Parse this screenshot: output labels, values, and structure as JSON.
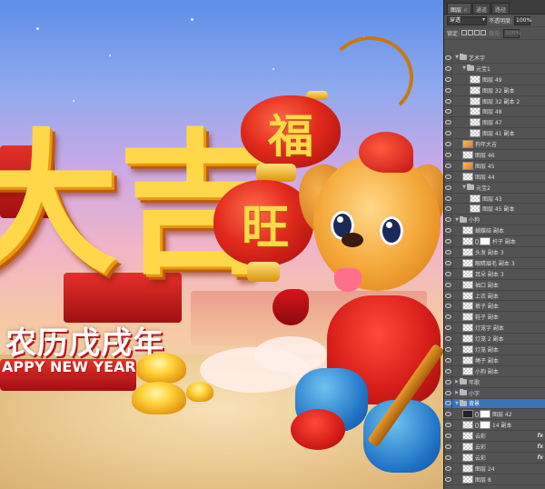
{
  "canvas": {
    "art_text_cn_big": "大吉",
    "lantern_top_char": "福",
    "lantern_bottom_char": "旺",
    "banner_cn": "农历戊戌年",
    "banner_en": "APPY NEW YEAR"
  },
  "panel": {
    "tabs": [
      {
        "label": "图层",
        "close": "×"
      },
      {
        "label": "通道"
      },
      {
        "label": "路径"
      }
    ],
    "blend_mode": "穿透",
    "opacity_label": "不透明度:",
    "opacity_value": "100%",
    "lock_label": "锁定:",
    "fill_label": "填充:",
    "fill_value": "100%",
    "layers": [
      {
        "name": "艺术字",
        "kind": "folder",
        "indent": 0,
        "open": true
      },
      {
        "name": "元宝1",
        "kind": "folder",
        "indent": 1,
        "open": true
      },
      {
        "name": "图层 49",
        "kind": "layer",
        "indent": 2
      },
      {
        "name": "图层 32 副本",
        "kind": "layer",
        "indent": 2
      },
      {
        "name": "图层 32 副本 2",
        "kind": "layer",
        "indent": 2
      },
      {
        "name": "图层 48",
        "kind": "layer",
        "indent": 2
      },
      {
        "name": "图层 47",
        "kind": "layer",
        "indent": 2
      },
      {
        "name": "图层 41 副本",
        "kind": "layer",
        "indent": 2
      },
      {
        "name": "狗年大吉",
        "kind": "layer",
        "indent": 1,
        "thumb": "art"
      },
      {
        "name": "图层 46",
        "kind": "layer",
        "indent": 1
      },
      {
        "name": "图层 45",
        "kind": "layer",
        "indent": 1,
        "thumb": "art"
      },
      {
        "name": "图层 44",
        "kind": "layer",
        "indent": 1
      },
      {
        "name": "元宝2",
        "kind": "folder",
        "indent": 1,
        "open": true
      },
      {
        "name": "图层 43",
        "kind": "layer",
        "indent": 2
      },
      {
        "name": "图层 45 副本",
        "kind": "layer",
        "indent": 2
      },
      {
        "name": "小狗",
        "kind": "folder",
        "indent": 0,
        "open": true
      },
      {
        "name": "蝴蝶结 副本",
        "kind": "layer",
        "indent": 1
      },
      {
        "name": "杆子 副本",
        "kind": "masked",
        "indent": 1
      },
      {
        "name": "头发 副本 3",
        "kind": "layer",
        "indent": 1
      },
      {
        "name": "眼睛眉毛 副本 3",
        "kind": "layer",
        "indent": 1
      },
      {
        "name": "耳朵 副本 3",
        "kind": "layer",
        "indent": 1
      },
      {
        "name": "袖口 副本",
        "kind": "layer",
        "indent": 1
      },
      {
        "name": "上衣 副本",
        "kind": "layer",
        "indent": 1
      },
      {
        "name": "裤子 副本",
        "kind": "layer",
        "indent": 1
      },
      {
        "name": "鞋子 副本",
        "kind": "layer",
        "indent": 1
      },
      {
        "name": "灯笼字 副本",
        "kind": "layer",
        "indent": 1
      },
      {
        "name": "灯笼 2 副本",
        "kind": "layer",
        "indent": 1
      },
      {
        "name": "灯笼 副本",
        "kind": "layer",
        "indent": 1
      },
      {
        "name": "绳子 副本",
        "kind": "layer",
        "indent": 1
      },
      {
        "name": "小狗 副本",
        "kind": "layer",
        "indent": 1
      },
      {
        "name": "年歌",
        "kind": "folder",
        "indent": 0,
        "open": false
      },
      {
        "name": "小字",
        "kind": "folder",
        "indent": 0,
        "open": false
      },
      {
        "name": "背景",
        "kind": "folder",
        "indent": 0,
        "open": true,
        "selected": true
      },
      {
        "name": "图层 42",
        "kind": "masked",
        "indent": 1,
        "thumb": "dark"
      },
      {
        "name": "14 副本",
        "kind": "masked",
        "indent": 1
      },
      {
        "name": "云彩",
        "kind": "layer",
        "indent": 1,
        "fx": "fx"
      },
      {
        "name": "云彩",
        "kind": "layer",
        "indent": 1,
        "fx": "fx"
      },
      {
        "name": "云彩",
        "kind": "layer",
        "indent": 1,
        "fx": "fx"
      },
      {
        "name": "图层 24",
        "kind": "layer",
        "indent": 1
      },
      {
        "name": "图层 8",
        "kind": "layer",
        "indent": 1
      }
    ]
  }
}
